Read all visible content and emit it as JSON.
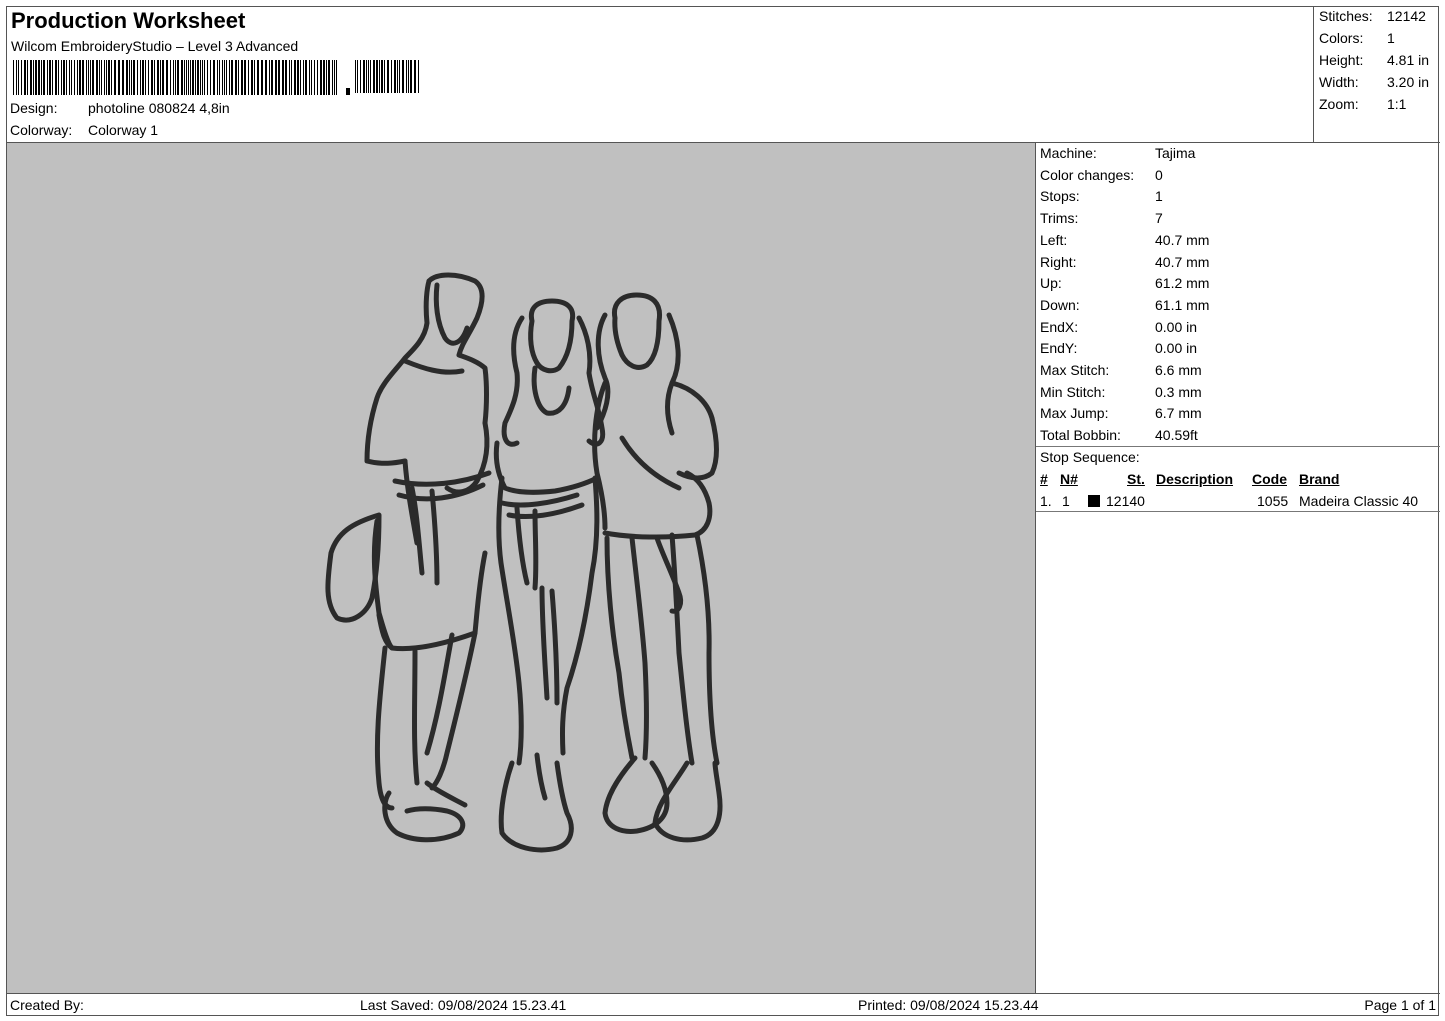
{
  "header": {
    "title": "Production Worksheet",
    "software": "Wilcom EmbroideryStudio – Level 3 Advanced",
    "design_label": "Design:",
    "design_value": "photoline 080824 4,8in",
    "colorway_label": "Colorway:",
    "colorway_value": "Colorway 1"
  },
  "summary": [
    {
      "label": "Stitches:",
      "value": "12142"
    },
    {
      "label": "Colors:",
      "value": "1"
    },
    {
      "label": "Height:",
      "value": "4.81 in"
    },
    {
      "label": "Width:",
      "value": "3.20 in"
    },
    {
      "label": "Zoom:",
      "value": "1:1"
    }
  ],
  "specs": [
    {
      "label": "Machine:",
      "value": "Tajima"
    },
    {
      "label": "Color changes:",
      "value": "0"
    },
    {
      "label": "Stops:",
      "value": "1"
    },
    {
      "label": "Trims:",
      "value": "7"
    },
    {
      "label": "Left:",
      "value": "40.7 mm"
    },
    {
      "label": "Right:",
      "value": "40.7 mm"
    },
    {
      "label": "Up:",
      "value": "61.2 mm"
    },
    {
      "label": "Down:",
      "value": "61.1 mm"
    },
    {
      "label": "EndX:",
      "value": "0.00 in"
    },
    {
      "label": "EndY:",
      "value": "0.00 in"
    },
    {
      "label": "Max Stitch:",
      "value": "6.6 mm"
    },
    {
      "label": "Min Stitch:",
      "value": "0.3 mm"
    },
    {
      "label": "Max Jump:",
      "value": "6.7 mm"
    },
    {
      "label": "Total Bobbin:",
      "value": "40.59ft"
    }
  ],
  "stop_sequence": {
    "title": "Stop Sequence:",
    "headers": {
      "num": "#",
      "needle": "N#",
      "stitches": "St.",
      "description": "Description",
      "code": "Code",
      "brand": "Brand"
    },
    "rows": [
      {
        "num": "1.",
        "needle": "1",
        "swatch_color": "#000000",
        "stitches": "12140",
        "description": "",
        "code": "1055",
        "brand": "Madeira Classic 40"
      }
    ]
  },
  "footer": {
    "created_by": "Created By:",
    "last_saved": "Last Saved: 09/08/2024 15.23.41",
    "printed": "Printed: 09/08/2024 15.23.44",
    "page": "Page 1 of 1"
  },
  "colors": {
    "canvas": "#c0c0c0",
    "thread": "#2b2b2b"
  }
}
